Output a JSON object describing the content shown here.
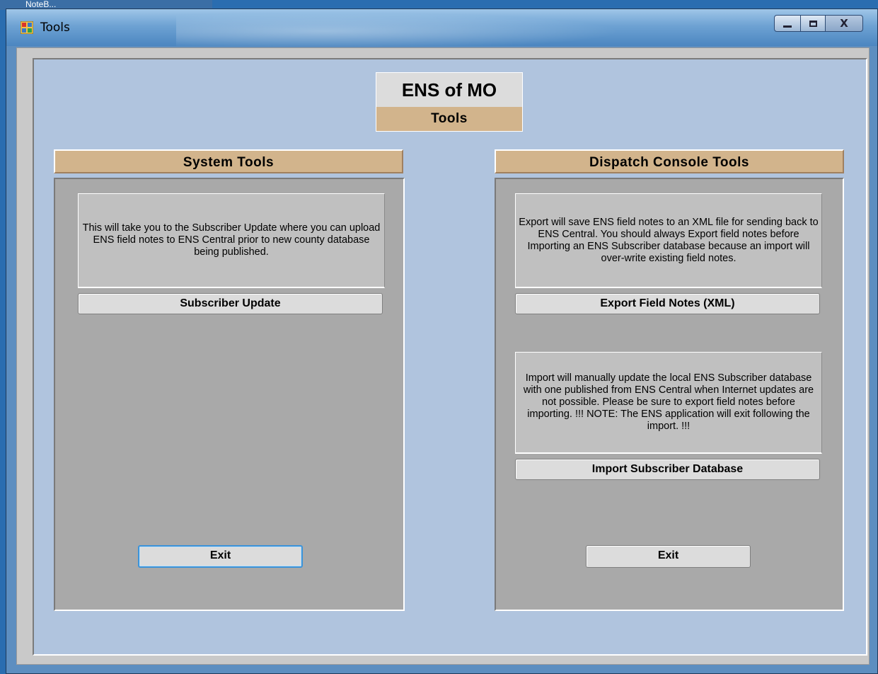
{
  "background_window": {
    "title": "NoteB..."
  },
  "window": {
    "title": "Tools",
    "controls": {
      "minimize": "minimize",
      "maximize": "maximize",
      "close_label": "X"
    }
  },
  "header": {
    "title": "ENS of MO",
    "subtitle": "Tools"
  },
  "system_tools": {
    "title": "System Tools",
    "description": "This will take you to the Subscriber Update where you can upload ENS field notes to ENS Central prior to new county database being published.",
    "subscriber_update_label": "Subscriber Update",
    "exit_label": "Exit"
  },
  "dispatch_tools": {
    "title": "Dispatch Console Tools",
    "export_description": "Export will save ENS field notes to an XML file for sending back to ENS Central. You should always Export field notes before Importing an ENS Subscriber database because an import will over-write existing field notes.",
    "export_label": "Export Field Notes (XML)",
    "import_description": "Import will manually update the local ENS Subscriber database with one published from ENS Central when Internet updates are not possible. Please be sure to export field notes before importing.  !!! NOTE: The ENS application will exit following the import. !!!",
    "import_label": "Import Subscriber Database",
    "exit_label": "Exit"
  },
  "colors": {
    "panel_background": "#b0c4de",
    "title_tan": "#d2b48c",
    "section_gray": "#a9a9a9",
    "description_gray": "#c0c0c0"
  }
}
